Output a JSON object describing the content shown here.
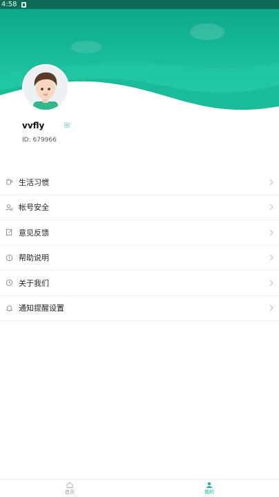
{
  "status_bar": {
    "time": "4:58"
  },
  "profile": {
    "username": "vvfly",
    "id_text": "ID: 679966"
  },
  "menu": [
    {
      "label": "生活习惯",
      "icon": "cup-icon"
    },
    {
      "label": "帐号安全",
      "icon": "user-shield-icon"
    },
    {
      "label": "意见反馈",
      "icon": "edit-note-icon"
    },
    {
      "label": "帮助说明",
      "icon": "info-circle-icon"
    },
    {
      "label": "关于我们",
      "icon": "clock-circle-icon"
    },
    {
      "label": "通知提醒设置",
      "icon": "bell-icon"
    }
  ],
  "tabbar": [
    {
      "label": "首页",
      "icon": "home-icon",
      "active": false
    },
    {
      "label": "我的",
      "icon": "person-icon",
      "active": true
    }
  ],
  "colors": {
    "accent": "#14b896",
    "header_dark": "#0f6b57",
    "header_light": "#2fd6b1"
  }
}
